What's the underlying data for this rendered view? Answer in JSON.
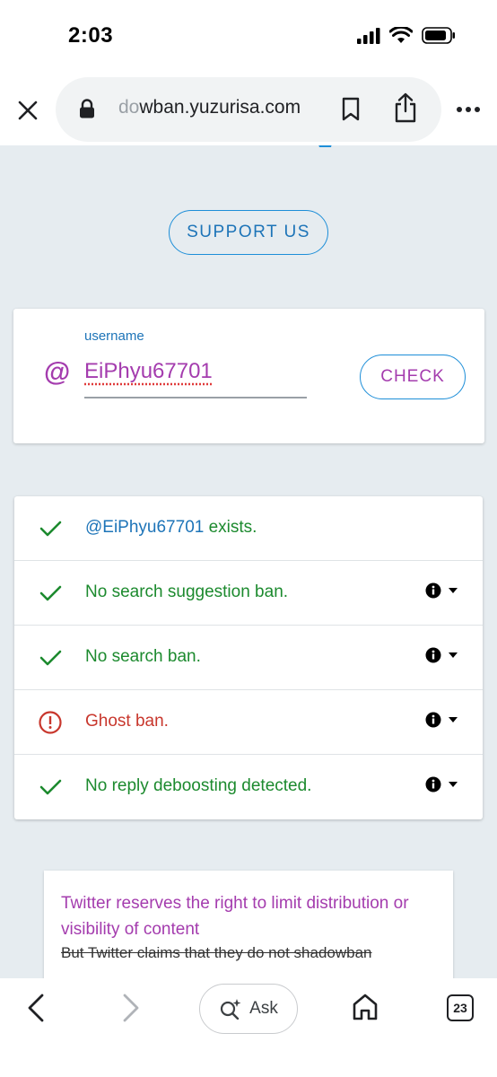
{
  "status_bar": {
    "time": "2:03"
  },
  "browser": {
    "url_faded": "do",
    "url_main": "wban.yuzurisa.com"
  },
  "page": {
    "support_label": "SUPPORT US",
    "username_label": "username",
    "at_symbol": "@",
    "username_value": "EiPhyu67701",
    "check_label": "CHECK"
  },
  "results": [
    {
      "status": "ok",
      "handle": "@EiPhyu67701",
      "text": " exists.",
      "has_info": false
    },
    {
      "status": "ok",
      "handle": "",
      "text": "No search suggestion ban.",
      "has_info": true
    },
    {
      "status": "ok",
      "handle": "",
      "text": "No search ban.",
      "has_info": true
    },
    {
      "status": "warning",
      "handle": "",
      "text": "Ghost ban.",
      "has_info": true
    },
    {
      "status": "ok",
      "handle": "",
      "text": "No reply deboosting detected.",
      "has_info": true
    }
  ],
  "notice": {
    "title": "Twitter reserves the right to limit distribution or visibility of content",
    "strikethrough": "But Twitter claims that they do not shadowban"
  },
  "bottom_bar": {
    "ask_label": "Ask",
    "tab_count": "23"
  },
  "colors": {
    "accent_blue": "#1d8ed8",
    "purple": "#a43cae",
    "green": "#1c8a2e",
    "red": "#c8372d",
    "page_bg": "#e6ecf0"
  }
}
